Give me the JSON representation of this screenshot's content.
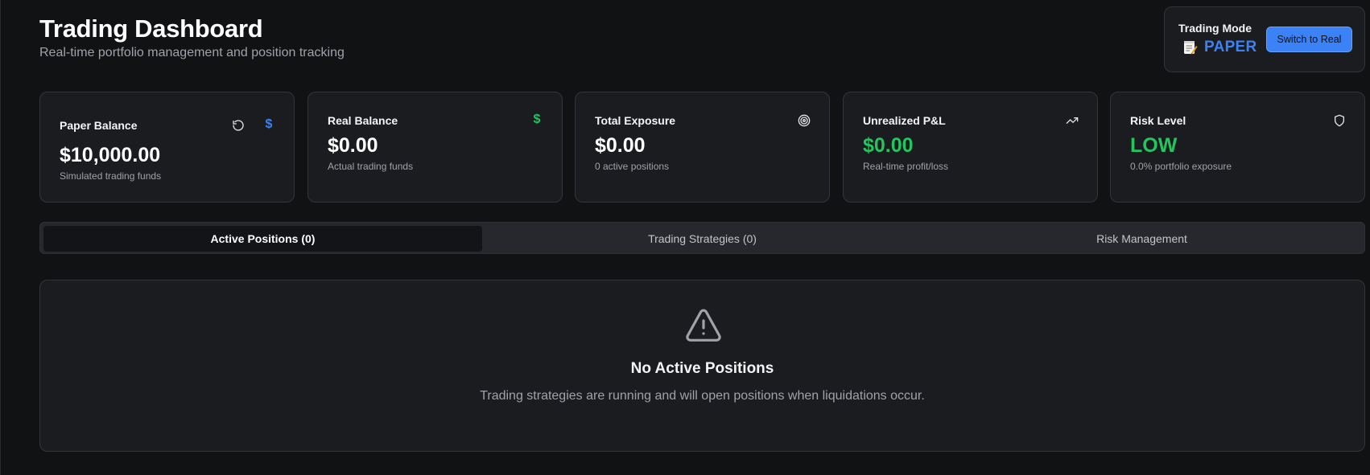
{
  "header": {
    "title": "Trading Dashboard",
    "subtitle": "Real-time portfolio management and position tracking"
  },
  "trading_mode": {
    "label": "Trading Mode",
    "value": "PAPER",
    "icon": "memo-icon",
    "switch_button_label": "Switch to Real"
  },
  "stats": [
    {
      "title": "Paper Balance",
      "value": "$10,000.00",
      "description": "Simulated trading funds",
      "icons": [
        "refresh-icon",
        "dollar-icon"
      ],
      "icon_color": "#3b82f6"
    },
    {
      "title": "Real Balance",
      "value": "$0.00",
      "description": "Actual trading funds",
      "icons": [
        "dollar-icon"
      ],
      "icon_color": "#22c55e"
    },
    {
      "title": "Total Exposure",
      "value": "$0.00",
      "description": "0 active positions",
      "icons": [
        "target-icon"
      ]
    },
    {
      "title": "Unrealized P&L",
      "value": "$0.00",
      "description": "Real-time profit/loss",
      "icons": [
        "trending-up-icon"
      ],
      "value_color": "#22c55e"
    },
    {
      "title": "Risk Level",
      "value": "LOW",
      "description": "0.0% portfolio exposure",
      "icons": [
        "shield-icon"
      ],
      "value_color": "#22c55e"
    }
  ],
  "tabs": [
    {
      "label": "Active Positions (0)",
      "active": true
    },
    {
      "label": "Trading Strategies (0)",
      "active": false
    },
    {
      "label": "Risk Management",
      "active": false
    }
  ],
  "empty_state": {
    "icon": "warning-icon",
    "title": "No Active Positions",
    "description": "Trading strategies are running and will open positions when liquidations occur."
  },
  "colors": {
    "background": "#111214",
    "card": "#1b1c20",
    "accent_blue": "#3b82f6",
    "positive_green": "#22c55e"
  }
}
